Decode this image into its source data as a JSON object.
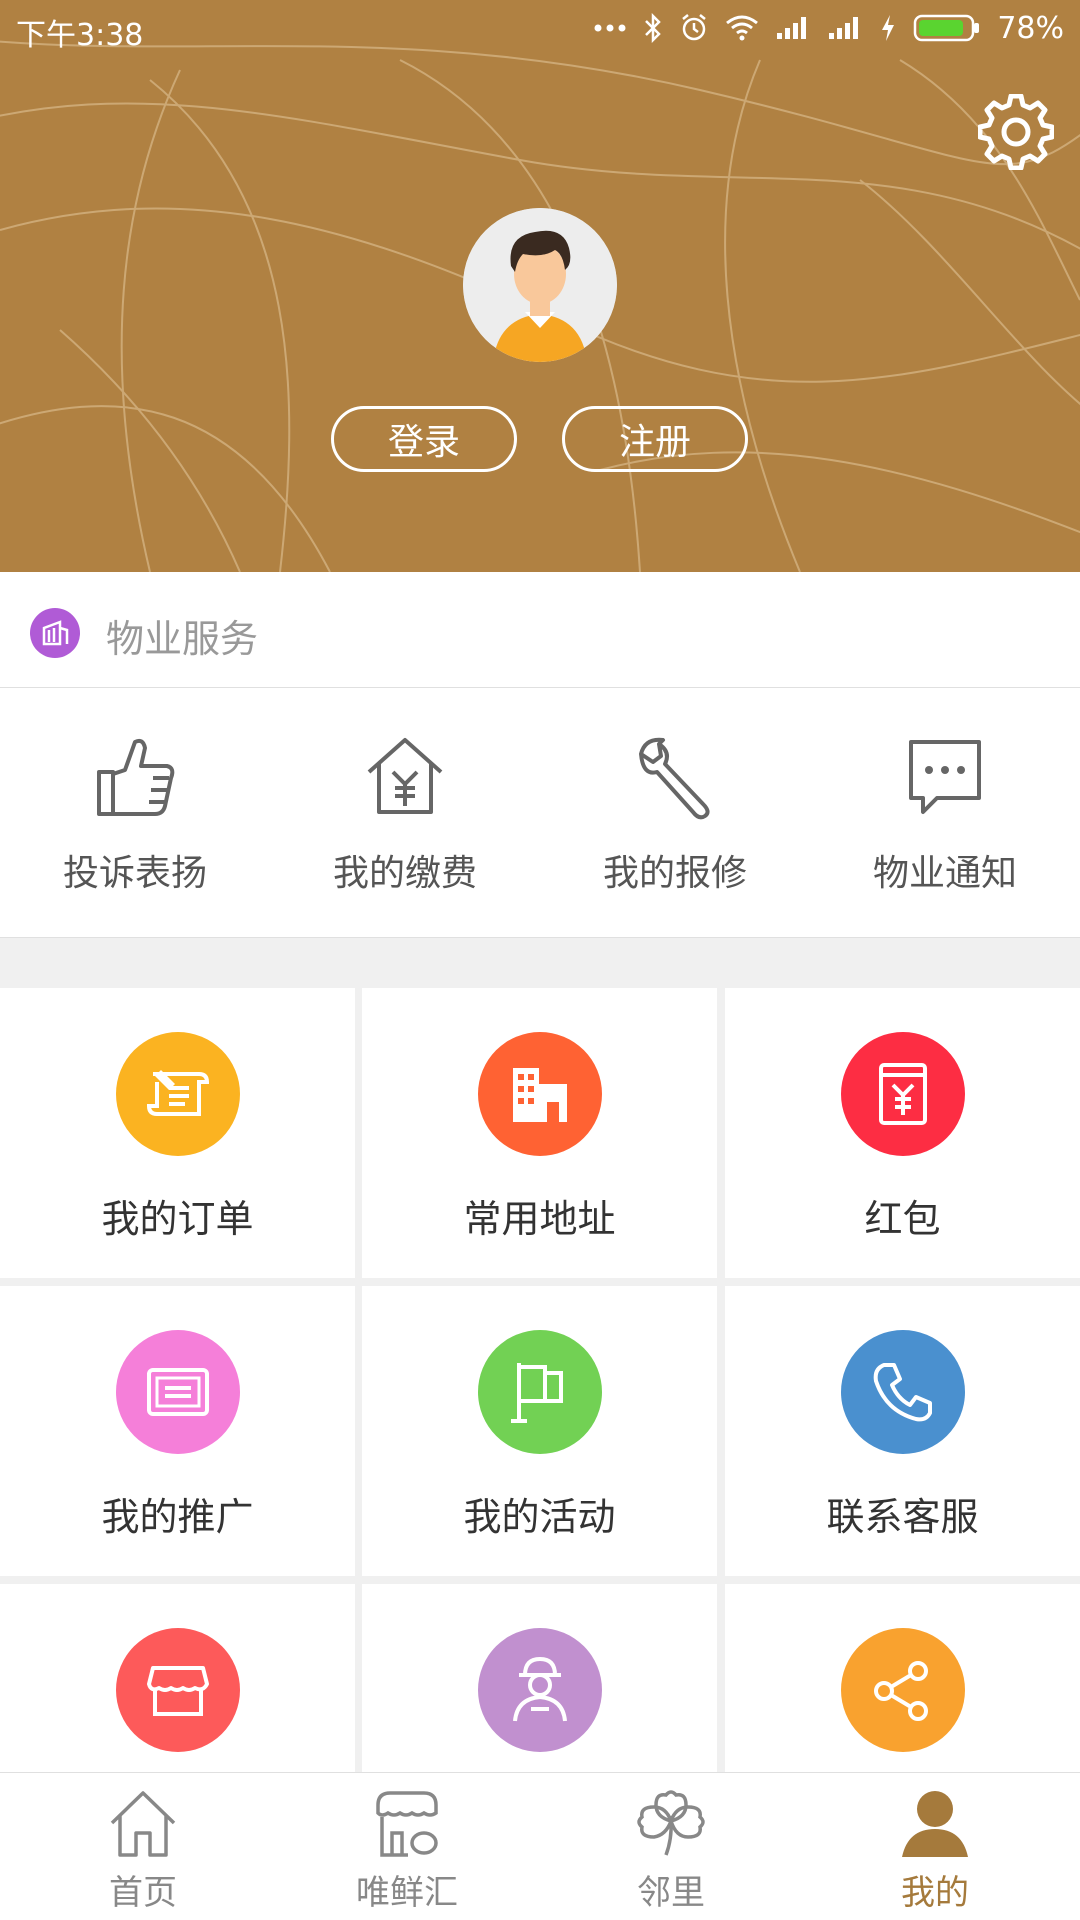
{
  "status_bar": {
    "time": "下午3:38",
    "battery": "78%"
  },
  "header": {
    "login_label": "登录",
    "register_label": "注册"
  },
  "property": {
    "title": "物业服务",
    "items": [
      {
        "label": "投诉表扬",
        "icon": "thumbs-up-icon"
      },
      {
        "label": "我的缴费",
        "icon": "house-yen-icon"
      },
      {
        "label": "我的报修",
        "icon": "wrench-icon"
      },
      {
        "label": "物业通知",
        "icon": "chat-bubble-icon"
      }
    ]
  },
  "grid": {
    "items": [
      {
        "label": "我的订单",
        "icon": "order-scroll-icon",
        "color": "#fbb321"
      },
      {
        "label": "常用地址",
        "icon": "building-icon",
        "color": "#ff6233"
      },
      {
        "label": "红包",
        "icon": "red-envelope-icon",
        "color": "#fd2d43"
      },
      {
        "label": "我的推广",
        "icon": "ticket-icon",
        "color": "#f57fd9"
      },
      {
        "label": "我的活动",
        "icon": "flag-icon",
        "color": "#72d154"
      },
      {
        "label": "联系客服",
        "icon": "phone-icon",
        "color": "#4a90cf"
      },
      {
        "label": "",
        "icon": "store-icon",
        "color": "#fd5a5a"
      },
      {
        "label": "",
        "icon": "worker-icon",
        "color": "#c190cf"
      },
      {
        "label": "",
        "icon": "share-icon",
        "color": "#f9a22f"
      }
    ]
  },
  "bottom_nav": {
    "items": [
      {
        "label": "首页",
        "icon": "home-icon"
      },
      {
        "label": "唯鲜汇",
        "icon": "shop-icon"
      },
      {
        "label": "邻里",
        "icon": "clover-icon"
      },
      {
        "label": "我的",
        "icon": "person-icon",
        "active": true
      }
    ]
  },
  "colors": {
    "header_bg": "#b08142",
    "accent": "#a57a3c"
  }
}
